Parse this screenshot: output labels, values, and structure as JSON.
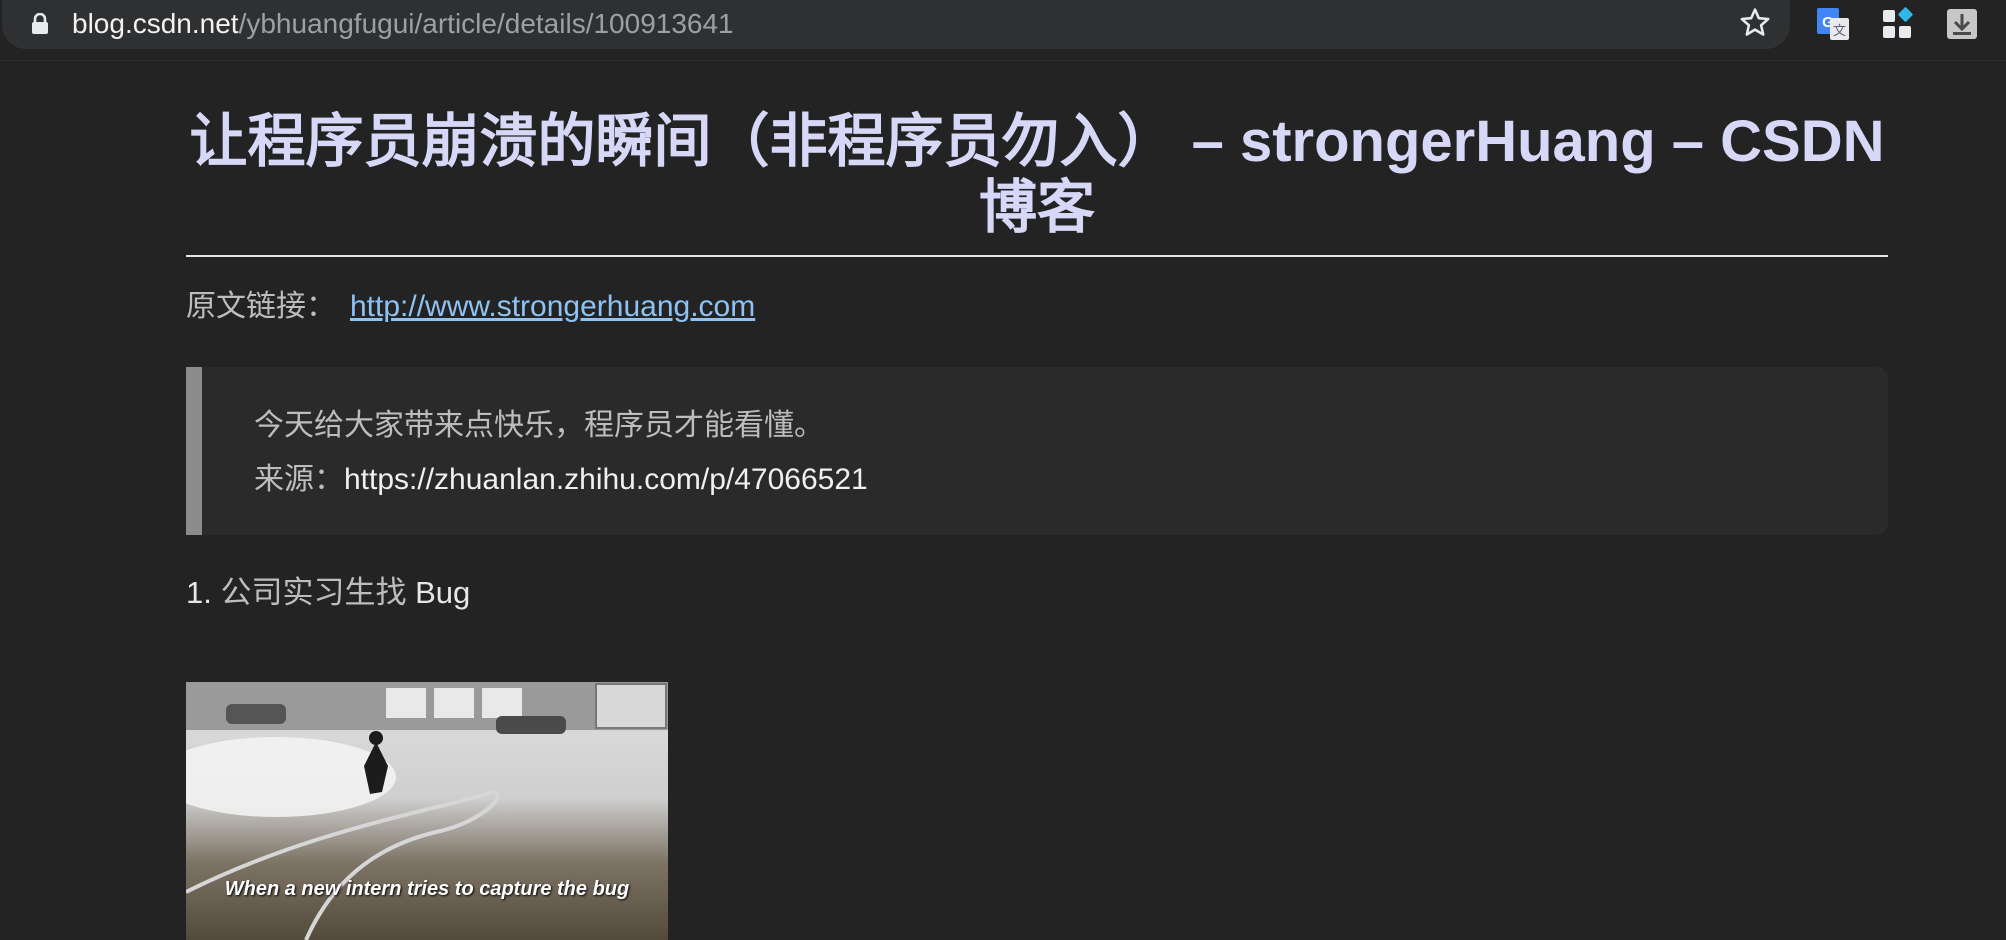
{
  "browser": {
    "url_host": "blog.csdn.net",
    "url_path": "/ybhuangfugui/article/details/100913641",
    "icons": [
      "lock-icon",
      "star-icon",
      "google-translate-icon",
      "extensions-icon",
      "download-icon"
    ],
    "colors": {
      "accent_blue": "#4285f4",
      "cyan": "#33b5e5"
    }
  },
  "article": {
    "title": "让程序员崩溃的瞬间（非程序员勿入） – strongerHuang – CSDN博客",
    "source_label": "原文链接：",
    "source_link": "http://www.strongerhuang.com",
    "quote": {
      "line1": "今天给大家带来点快乐，程序员才能看懂。",
      "line2_label": "来源：",
      "line2_url": "https://zhuanlan.zhihu.com/p/47066521"
    },
    "section1": {
      "number": "1.",
      "label_cn": "公司实习生找",
      "label_en": "Bug"
    },
    "gif_caption": "When a new intern tries to capture the bug"
  }
}
